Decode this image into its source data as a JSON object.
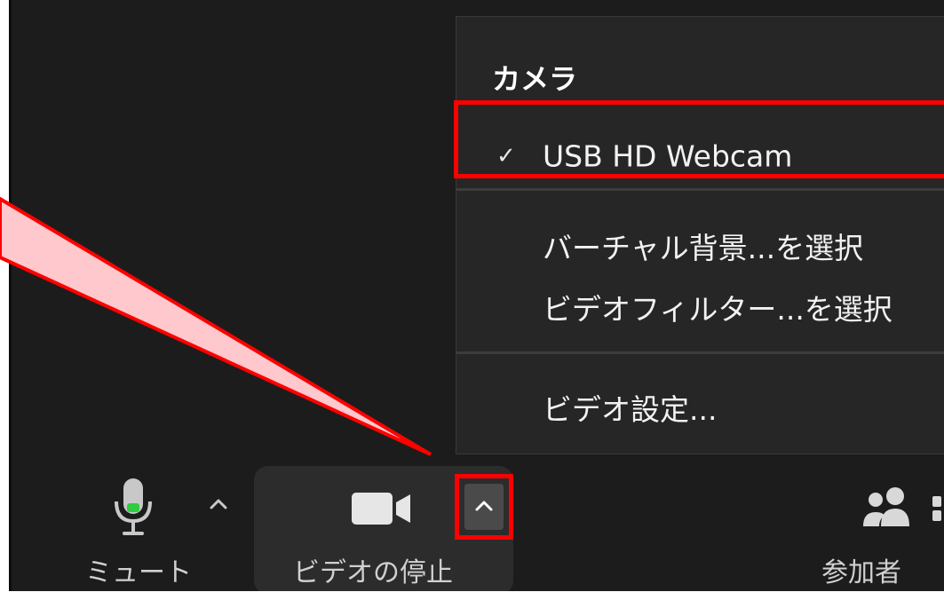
{
  "menu": {
    "title": "カメラ",
    "items": [
      {
        "label": "USB HD Webcam",
        "checked": true
      },
      {
        "label": "バーチャル背景...を選択",
        "checked": false
      },
      {
        "label": "ビデオフィルター...を選択",
        "checked": false
      },
      {
        "label": "ビデオ設定...",
        "checked": false
      }
    ],
    "check_glyph": "✓"
  },
  "toolbar": {
    "mute_label": "ミュート",
    "video_label": "ビデオの停止",
    "participants_label": "参加者"
  },
  "colors": {
    "background": "#1c1c1c",
    "menu_bg": "#262626",
    "highlight": "#ff0000",
    "callout_fill": "#ffc8cc",
    "mic_level": "#2ecc40"
  },
  "icons": [
    "microphone-icon",
    "caret-up-icon",
    "video-camera-icon",
    "participants-icon",
    "checkmark-icon"
  ]
}
